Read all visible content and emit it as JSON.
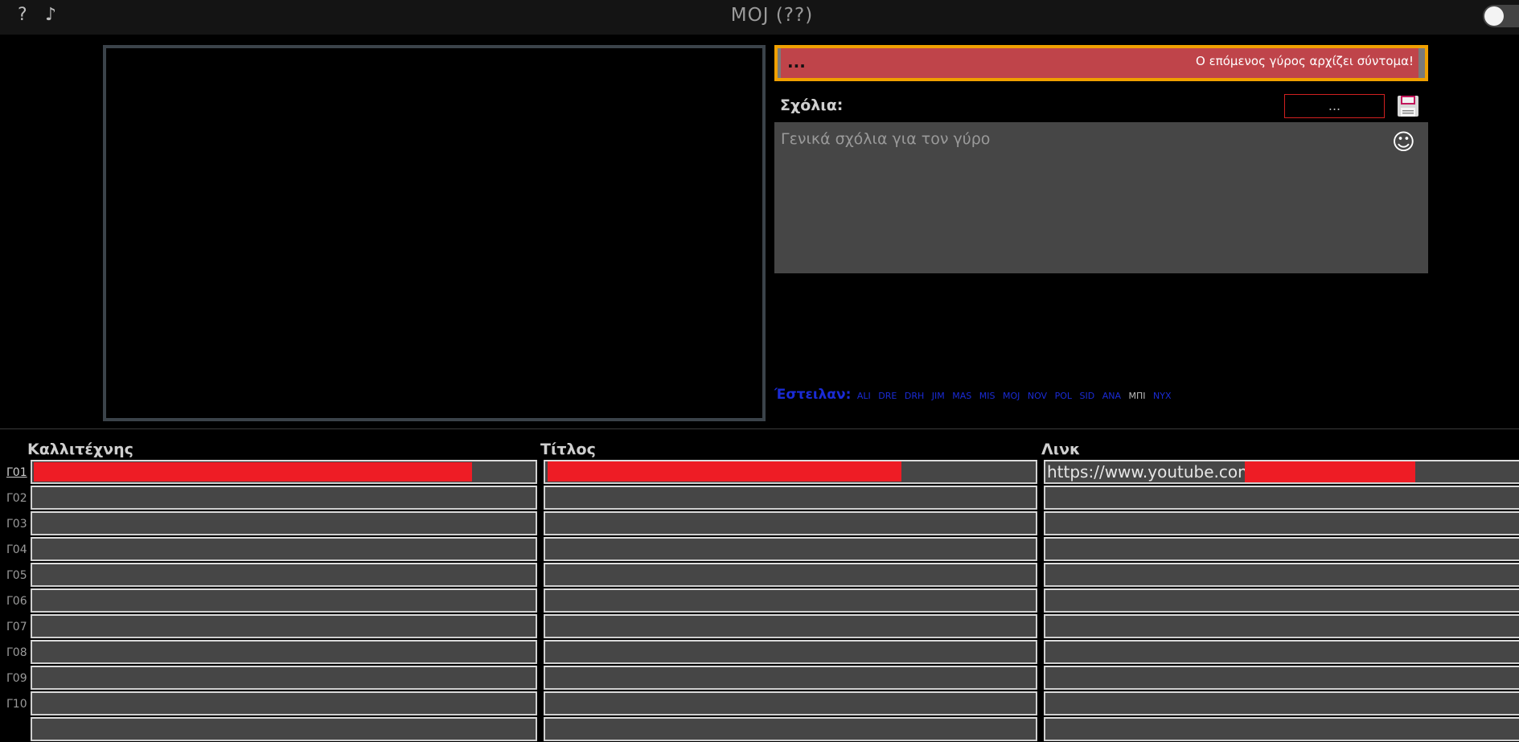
{
  "topbar": {
    "help_icon": "?",
    "music_icon": "♪",
    "title": "MOJ  (??)"
  },
  "status": {
    "dots": "...",
    "message": "Ο επόμενος γύρος αρχίζει σύντομα!"
  },
  "comments": {
    "label": "Σχόλια:",
    "small_input_value": "...",
    "placeholder": "Γενικά σχόλια για τον γύρο",
    "emoji_icon": "☺"
  },
  "sent": {
    "label": "Έστειλαν:",
    "names": [
      "ALI",
      "DRE",
      "DRH",
      "JIM",
      "MAS",
      "MIS",
      "MOJ",
      "NOV",
      "POL",
      "SID",
      "ANA",
      "ΜΠΙ",
      "NYX"
    ],
    "current_name": "ΜΠΙ"
  },
  "table": {
    "headers": [
      "Καλλιτέχνης",
      "Τίτλος",
      "Λινκ"
    ],
    "rows": [
      {
        "label": "Γ01",
        "link": "https://www.youtube.com/"
      },
      {
        "label": "Γ02",
        "link": ""
      },
      {
        "label": "Γ03",
        "link": ""
      },
      {
        "label": "Γ04",
        "link": ""
      },
      {
        "label": "Γ05",
        "link": ""
      },
      {
        "label": "Γ06",
        "link": ""
      },
      {
        "label": "Γ07",
        "link": ""
      },
      {
        "label": "Γ08",
        "link": ""
      },
      {
        "label": "Γ09",
        "link": ""
      },
      {
        "label": "Γ10",
        "link": ""
      }
    ]
  },
  "colors": {
    "status_border": "#f0a000",
    "status_fill": "#bf444a",
    "redaction": "#ee1c25",
    "sent_names": "#1a2bd6"
  }
}
